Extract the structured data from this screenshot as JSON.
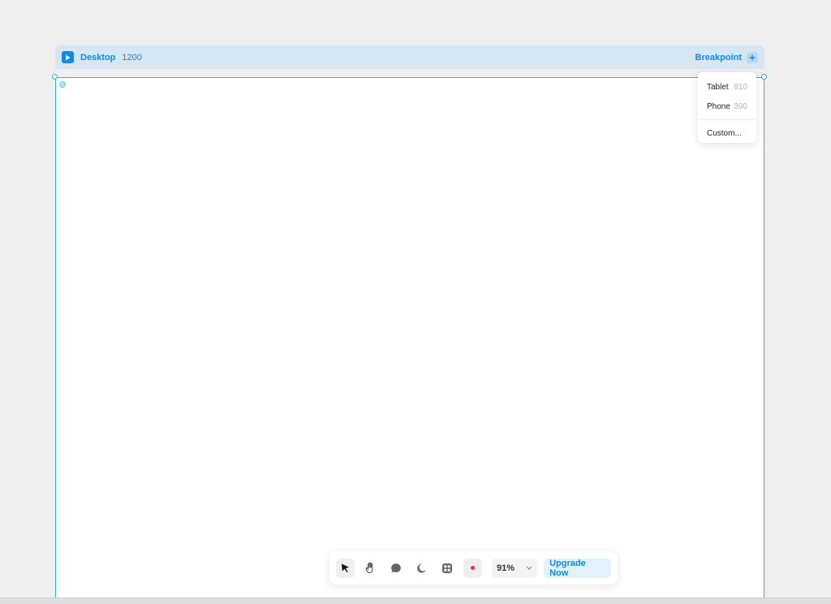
{
  "breakpoint_bar": {
    "name": "Desktop",
    "width": "1200",
    "add_label": "Breakpoint"
  },
  "breakpoint_menu": {
    "items": [
      {
        "label": "Tablet",
        "value": "810"
      },
      {
        "label": "Phone",
        "value": "390"
      }
    ],
    "custom_label": "Custom..."
  },
  "toolbar": {
    "tools": [
      "select-tool",
      "hand-tool",
      "comment-tool",
      "dark-mode-toggle",
      "components-tool",
      "record-button"
    ],
    "zoom": "91%",
    "upgrade_label": "Upgrade Now"
  },
  "colors": {
    "accent": "#0c8ce9",
    "frame_outline": "#33a9e8",
    "bar_background": "#d6e7f3",
    "record": "#e0344b"
  }
}
